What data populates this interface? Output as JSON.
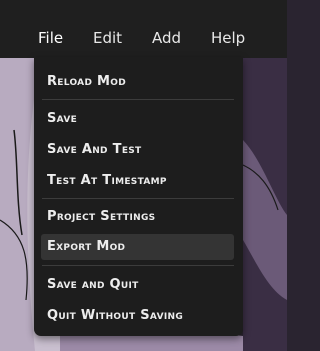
{
  "menubar": {
    "items": [
      "File",
      "Edit",
      "Add",
      "Help"
    ],
    "active": "File"
  },
  "file_menu": {
    "groups": [
      [
        "Reload Mod"
      ],
      [
        "Save",
        "Save And Test",
        "Test At Timestamp"
      ],
      [
        "Project Settings",
        "Export Mod"
      ],
      [
        "Save and Quit",
        "Quit Without Saving"
      ]
    ],
    "highlighted": "Export Mod"
  },
  "colors": {
    "menubar_bg": "#1f1f1f",
    "menu_bg": "#1d1d1d",
    "highlight_bg": "#343434",
    "text": "#ededed"
  }
}
